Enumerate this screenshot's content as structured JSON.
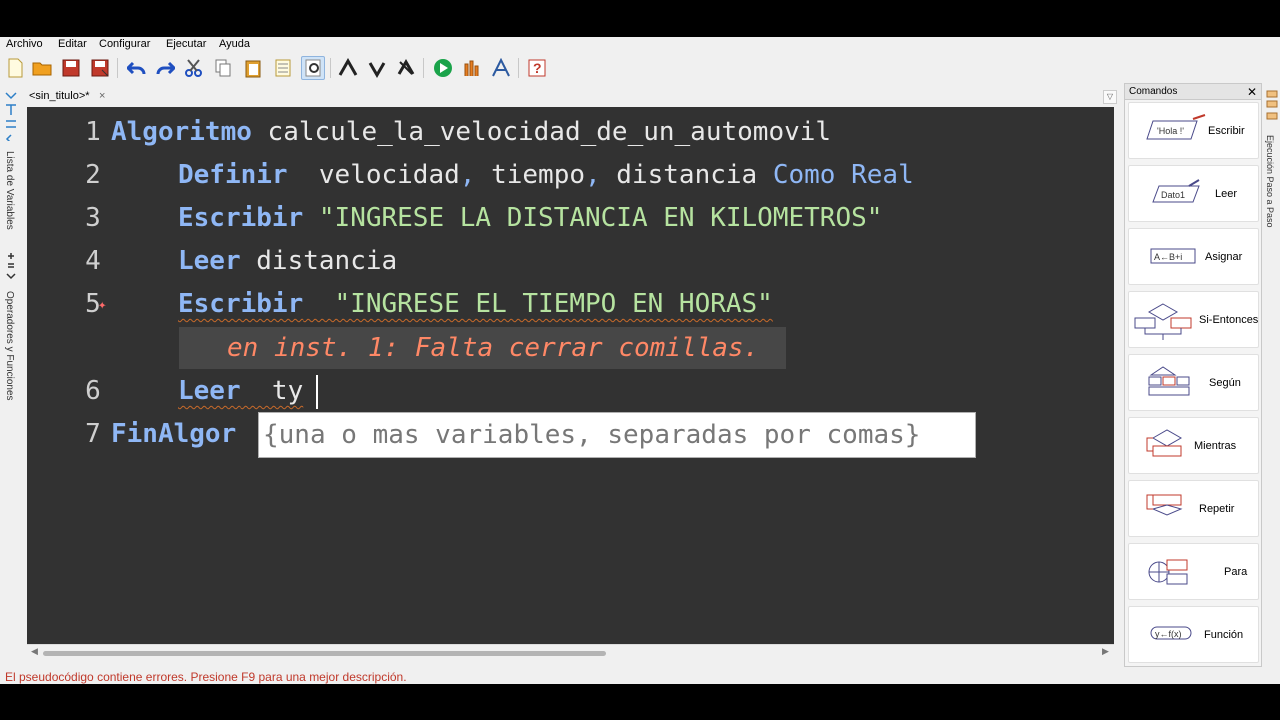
{
  "menu": [
    "Archivo",
    "Editar",
    "Configurar",
    "Ejecutar",
    "Ayuda"
  ],
  "toolbar": {
    "icons": [
      "new-file-icon",
      "open-file-icon",
      "save-icon",
      "save-as-icon",
      "undo-icon",
      "redo-icon",
      "cut-icon",
      "copy-icon",
      "paste-icon",
      "select-all-icon",
      "find-icon",
      "indent-icon",
      "unindent-icon",
      "comment-icon",
      "run-icon",
      "step-by-step-icon",
      "explain-icon",
      "help-icon"
    ]
  },
  "left_panel": {
    "variables_label": "Lista de Variables",
    "operators_label": "Operadores y Funciones"
  },
  "tab": {
    "title": "<sin_titulo>*",
    "close": "×"
  },
  "editor": {
    "line_numbers": [
      "1",
      "2",
      "3",
      "4",
      "5",
      "6",
      "7"
    ],
    "line1": {
      "keyword": "Algoritmo",
      "rest": " calcule_la_velocidad_de_un_automovil"
    },
    "line2": {
      "keyword": "Definir",
      "vars1": "  velocidad",
      "c1": ",",
      "vars2": " tiempo",
      "c2": ",",
      "vars3": " distancia ",
      "type": "Como Real"
    },
    "line3": {
      "keyword": "Escribir",
      "string": " \"INGRESE LA DISTANCIA EN KILOMETROS\""
    },
    "line4": {
      "keyword": "Leer",
      "rest": " distancia"
    },
    "line5": {
      "keyword": "Escribir",
      "string": "  \"INGRESE EL TIEMPO EN HORAS\""
    },
    "error_message": "en inst. 1: Falta cerrar comillas.",
    "line6": {
      "keyword": "Leer",
      "rest": "  ty"
    },
    "line7": {
      "keyword": "FinAlgor"
    },
    "error_marker": "✦",
    "tooltip": "{una o mas variables, separadas por comas}"
  },
  "status": "El pseudocódigo contiene errores. Presione F9 para una mejor descripción.",
  "commands": {
    "title": "Comandos",
    "close": "✕",
    "items": [
      {
        "label": "Escribir",
        "icon_text": "'Hola !'"
      },
      {
        "label": "Leer",
        "icon_text": "Dato1"
      },
      {
        "label": "Asignar",
        "icon_text": "A←B+i"
      },
      {
        "label": "Si-Entonces",
        "icon_text": ""
      },
      {
        "label": "Según",
        "icon_text": ""
      },
      {
        "label": "Mientras",
        "icon_text": ""
      },
      {
        "label": "Repetir",
        "icon_text": ""
      },
      {
        "label": "Para",
        "icon_text": ""
      },
      {
        "label": "Función",
        "icon_text": "y←f(x)"
      }
    ]
  },
  "right_strip": {
    "label": "Ejecución Paso a Paso"
  },
  "colors": {
    "editor_bg": "#323232",
    "keyword": "#8fb7f5",
    "string": "#b6e3a0",
    "error": "#ff8866"
  }
}
